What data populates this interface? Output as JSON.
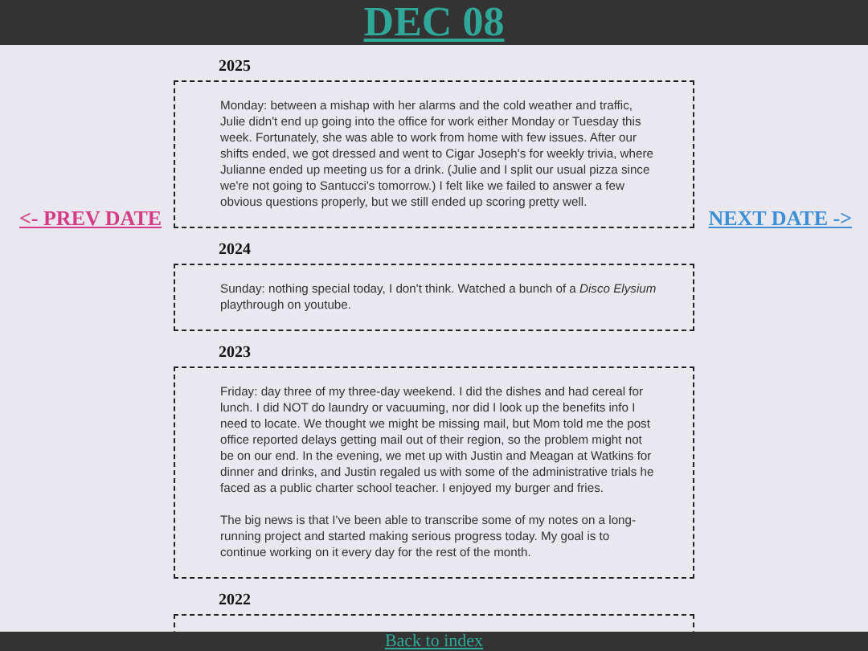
{
  "title": "DEC 08",
  "prev_link": "<- PREV DATE",
  "next_link": "NEXT DATE ->",
  "entries": [
    {
      "year": "2025",
      "paragraphs": [
        "Monday: between a mishap with her alarms and the cold weather and traffic, Julie didn't end up going into the office for work either Monday or Tuesday this week. Fortunately, she was able to work from home with few issues. After our shifts ended, we got dressed and went to Cigar Joseph's for weekly trivia, where Julianne ended up meeting us for a drink. (Julie and I split our usual pizza since we're not going to Santucci's tomorrow.) I felt like we failed to answer a few obvious questions properly, but we still ended up scoring pretty well."
      ]
    },
    {
      "year": "2024",
      "paragraphs": [
        "Sunday: nothing special today, I don't think. Watched a bunch of a *Disco Elysium* playthrough on youtube."
      ]
    },
    {
      "year": "2023",
      "paragraphs": [
        "Friday: day three of my three-day weekend. I did the dishes and had cereal for lunch. I did NOT do laundry or vacuuming, nor did I look up the benefits info I need to locate. We thought we might be missing mail, but Mom told me the post office reported delays getting mail out of their region, so the problem might not be on our end. In the evening, we met up with Justin and Meagan at Watkins for dinner and drinks, and Justin regaled us with some of the administrative trials he faced as a public charter school teacher. I enjoyed my burger and fries.",
        "The big news is that I've been able to transcribe some of my notes on a long-running project and started making serious progress today. My goal is to continue working on it every day for the rest of the month."
      ]
    },
    {
      "year": "2022"
    }
  ],
  "footer_link": "Back to index"
}
